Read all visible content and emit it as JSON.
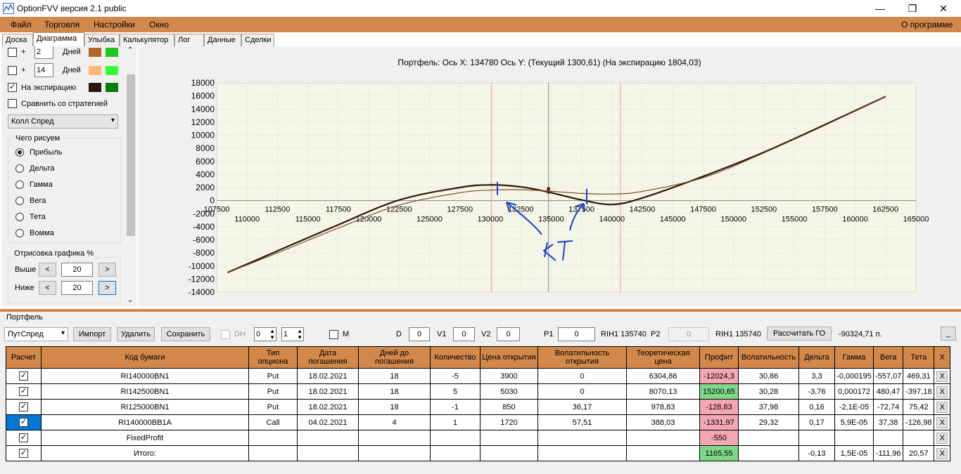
{
  "window": {
    "title": "OptionFVV версия 2.1 public",
    "minimize": "—",
    "maximize": "❐",
    "close": "✕"
  },
  "menu": {
    "items": [
      "Файл",
      "Торговля",
      "Настройки",
      "Окно"
    ],
    "about": "О программе"
  },
  "tabs": [
    "Доска",
    "Диаграмма",
    "Улыбка",
    "Калькулятор",
    "Лог",
    "Данные",
    "Сделки"
  ],
  "left": {
    "row1": {
      "plus": "+",
      "value": "2",
      "unit": "Дней",
      "color1": "#b4652a",
      "color2": "#1fc71f"
    },
    "row2": {
      "plus": "+",
      "value": "14",
      "unit": "Дней",
      "color1": "#ffb777",
      "color2": "#33ff33"
    },
    "expiry": {
      "label": "На экспирацию",
      "checked": "✓",
      "color1": "#2b1608",
      "color2": "#008000"
    },
    "compare": "Сравнить со стратегией",
    "strategy": "Колл Спред",
    "draw_group": "Чего рисуем",
    "draw_options": [
      "Прибыль",
      "Дельта",
      "Гамма",
      "Вега",
      "Тета",
      "Вомма"
    ],
    "render_group": "Отрисовка графика %",
    "above_label": "Выше",
    "above_value": "20",
    "below_label": "Ниже",
    "below_value": "20",
    "dec": "<",
    "inc": ">"
  },
  "chart_title": "Портфель: Ось X: 134780 Ось Y:  (Текущий 1300,61)  (На экспирацию 1804,03)",
  "chart_data": {
    "type": "line",
    "title": "Портфель: Ось X: 134780 Ось Y:  (Текущий 1300,61)  (На экспирацию 1804,03)",
    "xlim": [
      107500,
      165000
    ],
    "ylim": [
      -14000,
      18000
    ],
    "yticks": [
      18000,
      16000,
      14000,
      12000,
      10000,
      8000,
      6000,
      4000,
      2000,
      0,
      -2000,
      -4000,
      -6000,
      -8000,
      -10000,
      -12000,
      -14000
    ],
    "xticks_top": [
      107500,
      112500,
      117500,
      122500,
      127500,
      132500,
      137500,
      142500,
      147500,
      152500,
      157500,
      162500
    ],
    "xticks_bottom": [
      110000,
      115000,
      120000,
      125000,
      130000,
      135000,
      140000,
      145000,
      150000,
      155000,
      160000,
      165000
    ],
    "grid": true,
    "vlines": [
      {
        "x": 130100,
        "color": "#f4a6b2"
      },
      {
        "x": 134780,
        "color": "#8a9aa8"
      },
      {
        "x": 140700,
        "color": "#f4a6b2"
      }
    ],
    "series": [
      {
        "color": "#2b1608",
        "x": [
          108400,
          112500,
          117500,
          122500,
          127500,
          130000,
          132500,
          134780,
          137500,
          140000,
          142500,
          147500,
          152500,
          157500,
          162500
        ],
        "y": [
          -11000,
          -7700,
          -3700,
          80,
          2000,
          2400,
          2100,
          1300,
          100,
          -600,
          400,
          3700,
          7400,
          11600,
          15900
        ]
      },
      {
        "color": "#7a4a2a",
        "x": [
          108400,
          112500,
          117500,
          122500,
          127500,
          130000,
          132500,
          134780,
          137500,
          140000,
          142500,
          147500,
          152500,
          157500,
          162500
        ],
        "y": [
          -11000,
          -8000,
          -4200,
          -700,
          1200,
          1600,
          1650,
          1450,
          1100,
          1000,
          1400,
          3500,
          7300,
          11500,
          15900
        ]
      }
    ],
    "markers": [
      {
        "x": 134780,
        "y": 1800
      },
      {
        "x": 134780,
        "y": 1300
      }
    ]
  },
  "portfolio": {
    "group": "Портфель",
    "combo": "ПутСпред",
    "import": "Импорт",
    "delete": "Удалить",
    "save": "Сохранить",
    "dh": "DH",
    "spin1": "0",
    "spin2": "1",
    "m": "M",
    "d_label": "D",
    "d_value": "0",
    "v1_label": "V1",
    "v1_value": "0",
    "v2_label": "V2",
    "v2_value": "0",
    "p1_label": "P1",
    "p1_value": "0",
    "rih1": "RIH1 135740",
    "p2_label": "P2",
    "p2_value": "0",
    "rih2": "RIH1 135740",
    "calc": "Рассчитать ГО",
    "go_value": "-90324,71 п.",
    "min": "_"
  },
  "table": {
    "headers": [
      "Расчет",
      "Код бумаги",
      "Тип опциона",
      "Дата погашения",
      "Дней до погашения",
      "Количество",
      "Цена открытия",
      "Волатильность открытия",
      "Теоретическая цена",
      "Профит",
      "Волатильность",
      "Дельта",
      "Гамма",
      "Вега",
      "Тета",
      "X"
    ],
    "rows": [
      [
        "✓",
        "RI140000BN1",
        "Put",
        "18.02.2021",
        "18",
        "-5",
        "3900",
        "0",
        "6304,86",
        "-12024,3",
        "30,86",
        "3,3",
        "-0,000195",
        "-557,07",
        "469,31",
        "X"
      ],
      [
        "✓",
        "RI142500BN1",
        "Put",
        "18.02.2021",
        "18",
        "5",
        "5030",
        "0",
        "8070,13",
        "15200,65",
        "30,28",
        "-3,76",
        "0,000172",
        "480,47",
        "-397,18",
        "X"
      ],
      [
        "✓",
        "RI125000BN1",
        "Put",
        "18.02.2021",
        "18",
        "-1",
        "850",
        "36,17",
        "978,83",
        "-128,83",
        "37,98",
        "0,16",
        "-2,1E-05",
        "-72,74",
        "75,42",
        "X"
      ],
      [
        "✓",
        "RI140000BB1A",
        "Call",
        "04.02.2021",
        "4",
        "1",
        "1720",
        "57,51",
        "388,03",
        "-1331,97",
        "29,32",
        "0,17",
        "5,9E-05",
        "37,38",
        "-126,98",
        "X"
      ],
      [
        "✓",
        "FixedProfit",
        "",
        "",
        "",
        "",
        "",
        "",
        "",
        "-550",
        "",
        "",
        "",
        "",
        "",
        "X"
      ],
      [
        "✓",
        "Итого:",
        "",
        "",
        "",
        "",
        "",
        "",
        "",
        "1165,55",
        "",
        "-0,13",
        "1,5E-05",
        "-111,96",
        "20,57",
        "X"
      ]
    ],
    "profit_colors": [
      "neg",
      "pos",
      "neg",
      "neg",
      "neg",
      "pos"
    ]
  }
}
